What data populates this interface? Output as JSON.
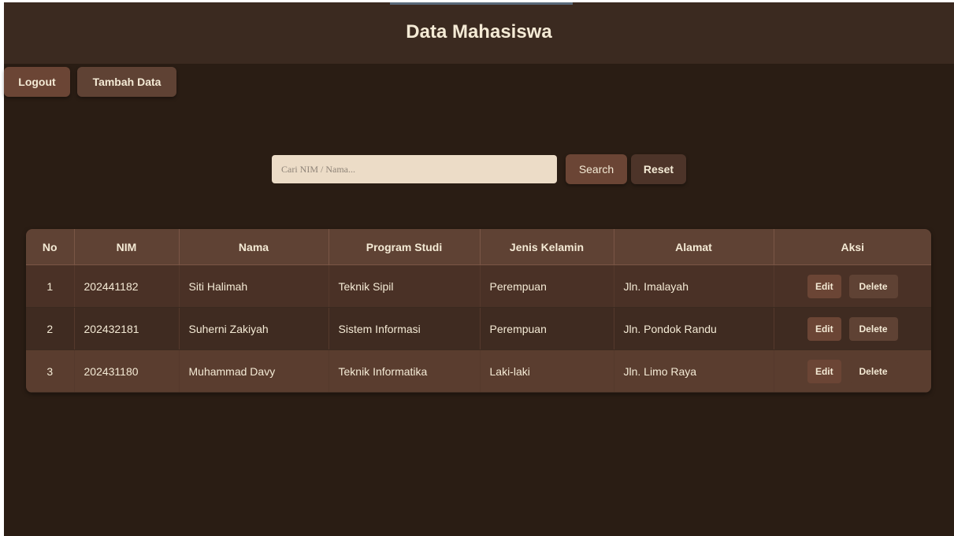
{
  "header": {
    "title": "Data Mahasiswa"
  },
  "actions": {
    "logout_label": "Logout",
    "tambah_label": "Tambah Data"
  },
  "search": {
    "placeholder": "Cari NIM / Nama...",
    "value": "",
    "search_label": "Search",
    "reset_label": "Reset"
  },
  "table": {
    "columns": [
      "No",
      "NIM",
      "Nama",
      "Program Studi",
      "Jenis Kelamin",
      "Alamat",
      "Aksi"
    ],
    "rows": [
      {
        "no": "1",
        "nim": "202441182",
        "nama": "Siti Halimah",
        "prodi": "Teknik Sipil",
        "jk": "Perempuan",
        "alamat": "Jln. Imalayah",
        "edit": "Edit",
        "delete": "Delete"
      },
      {
        "no": "2",
        "nim": "202432181",
        "nama": "Suherni Zakiyah",
        "prodi": "Sistem Informasi",
        "jk": "Perempuan",
        "alamat": "Jln. Pondok Randu",
        "edit": "Edit",
        "delete": "Delete"
      },
      {
        "no": "3",
        "nim": "202431180",
        "nama": "Muhammad Davy",
        "prodi": "Teknik Informatika",
        "jk": "Laki-laki",
        "alamat": "Jln. Limo Raya",
        "edit": "Edit",
        "delete": "Delete"
      }
    ]
  },
  "colors": {
    "background": "#2a1d14",
    "header": "#3b2a20",
    "accent": "#6b4535",
    "text": "#f4ead5",
    "input": "#ecdcc7"
  }
}
